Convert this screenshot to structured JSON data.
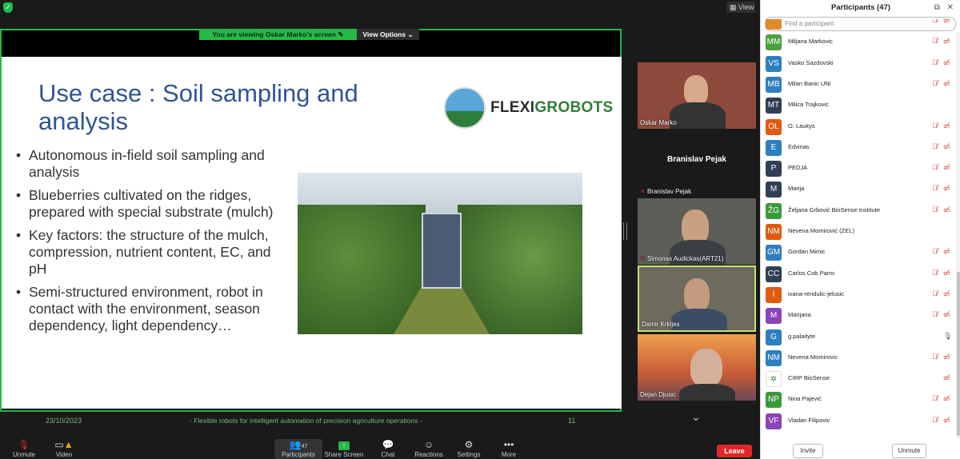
{
  "window": {
    "view_label": "View"
  },
  "share": {
    "viewing_text": "You are viewing  Oskar Marko's screen",
    "view_options": "View Options"
  },
  "slide": {
    "title": "Use case : Soil sampling and analysis",
    "logo_text_a": "FLEXI",
    "logo_text_b": "GROBOTS",
    "bullets": [
      "Autonomous in-field soil sampling and analysis",
      "Blueberries cultivated on the ridges, prepared with special substrate (mulch)",
      "Key factors: the structure of the mulch, compression, nutrient content, EC, and pH",
      "Semi-structured environment, robot in contact with the environment, season dependency, light dependency…"
    ],
    "footer_date": "23/10/2023",
    "footer_text": "- Flexible robots for intelligent automation of precision agriculture operations -",
    "footer_page": "11"
  },
  "videos": [
    {
      "name": "Oskar Marko"
    },
    {
      "name": "Branislav Pejak",
      "big": "Branislav Pejak"
    },
    {
      "name": "Simonas Audickas(ART21)"
    },
    {
      "name": "Damir Krkljes"
    },
    {
      "name": "Dejan Djusic"
    }
  ],
  "toolbar": {
    "unmute": "Unmute",
    "video": "Video",
    "participants": "Participants",
    "participants_count": "47",
    "share_screen": "Share Screen",
    "chat": "Chat",
    "reactions": "Reactions",
    "settings": "Settings",
    "more": "More",
    "leave": "Leave"
  },
  "panel": {
    "title": "Participants (47)",
    "search_placeholder": "Find a participant",
    "invite": "Invite",
    "unmute": "Unmute",
    "participants": [
      {
        "initials": "",
        "name": "",
        "color": "#e08a2a",
        "mic": "off",
        "cam": "off"
      },
      {
        "initials": "MM",
        "name": "Miljana Markovic",
        "color": "#4b9f3f",
        "mic": "off",
        "cam": "off"
      },
      {
        "initials": "VS",
        "name": "Vasko Sazdovski",
        "color": "#2d7fc1",
        "mic": "off",
        "cam": "off"
      },
      {
        "initials": "MB",
        "name": "Milan Banic UNI",
        "color": "#2d7fc1",
        "mic": "off",
        "cam": "off"
      },
      {
        "initials": "MT",
        "name": "Milica Trajkovic",
        "color": "#2f3f55",
        "mic": "none",
        "cam": "none"
      },
      {
        "initials": "OL",
        "name": "O. Laukys",
        "color": "#e05a10",
        "mic": "off",
        "cam": "off"
      },
      {
        "initials": "E",
        "name": "Edvinas",
        "color": "#2d7fc1",
        "mic": "off",
        "cam": "off"
      },
      {
        "initials": "P",
        "name": "PEDJA",
        "color": "#2f3f55",
        "mic": "off",
        "cam": "off"
      },
      {
        "initials": "M",
        "name": "Marija",
        "color": "#2f3f55",
        "mic": "off",
        "cam": "off"
      },
      {
        "initials": "ŽG",
        "name": "Željana Grbović BioSense Institute",
        "color": "#3a9a3a",
        "mic": "off",
        "cam": "off"
      },
      {
        "initials": "NM",
        "name": "Nevena Momirović (ZEL)",
        "color": "#e05a10",
        "mic": "none",
        "cam": "none"
      },
      {
        "initials": "GM",
        "name": "Gordan Mimic",
        "color": "#2d7fc1",
        "mic": "off",
        "cam": "off"
      },
      {
        "initials": "CC",
        "name": "Carlos Cob Parro",
        "color": "#2f3f55",
        "mic": "off",
        "cam": "off"
      },
      {
        "initials": "I",
        "name": "ivana-rendulic-jelusic",
        "color": "#e05a10",
        "mic": "off",
        "cam": "off"
      },
      {
        "initials": "M",
        "name": "Marijana",
        "color": "#8b44b8",
        "mic": "off",
        "cam": "off"
      },
      {
        "initials": "G",
        "name": "g.palaityte",
        "color": "#2d7fc1",
        "mic": "on",
        "cam": "none"
      },
      {
        "initials": "NM",
        "name": "Nevena Momirovic",
        "color": "#2d7fc1",
        "mic": "off",
        "cam": "off"
      },
      {
        "initials": "",
        "name": "CIRP BioSense",
        "color": "#ffffff",
        "mic": "none",
        "cam": "off"
      },
      {
        "initials": "NP",
        "name": "Nina Pajević",
        "color": "#3a9a3a",
        "mic": "off",
        "cam": "off"
      },
      {
        "initials": "VF",
        "name": "Vladan Filipovic",
        "color": "#8b44b8",
        "mic": "off",
        "cam": "off"
      }
    ]
  }
}
